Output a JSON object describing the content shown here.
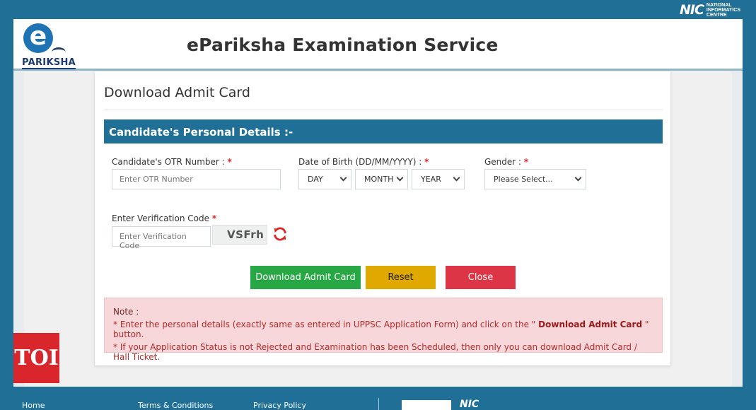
{
  "top_banner": {
    "org_mark": "NIC",
    "org_words": [
      "NATIONAL",
      "INFORMATICS",
      "CENTRE"
    ]
  },
  "header": {
    "logo_letter": "e",
    "logo_word": "PARIKSHA",
    "title": "eParikshа Examination Service"
  },
  "page": {
    "title": "Download Admit Card"
  },
  "section": {
    "title": "Candidate's Personal Details :-"
  },
  "form": {
    "otr_label": "Candidate's OTR Number :",
    "otr_placeholder": "Enter OTR Number",
    "dob_label": "Date of Birth (DD/MM/YYYY) :",
    "dob_day": "DAY",
    "dob_month": "MONTH",
    "dob_year": "YEAR",
    "gender_label": "Gender :",
    "gender_value": "Please Select...",
    "verify_label": "Enter Verification Code",
    "verify_placeholder": "Enter Verification Code",
    "captcha_text": "VSFrh",
    "required_mark": "*"
  },
  "buttons": {
    "download": "Download Admit Card",
    "reset": "Reset",
    "close": "Close"
  },
  "note": {
    "title": "Note :",
    "line1_pre": "* Enter the personal details (exactly same as entered in UPPSC Application Form) and click on the \"",
    "line1_bold": "Download Admit Card",
    "line1_post": "\" button.",
    "line2": "* If your Application Status is not Rejected and Examination has been Scheduled, then only you can download Admit Card / Hall Ticket."
  },
  "footer": {
    "links": [
      "Home",
      "Terms & Conditions",
      "Privacy Policy"
    ],
    "nic_mark": "NIC"
  },
  "badge": {
    "text": "TOI"
  },
  "colors": {
    "primary": "#1f6f97",
    "green": "#28a745",
    "yellow": "#e0a900",
    "red": "#dc3545",
    "note_bg": "#f8d7da"
  }
}
